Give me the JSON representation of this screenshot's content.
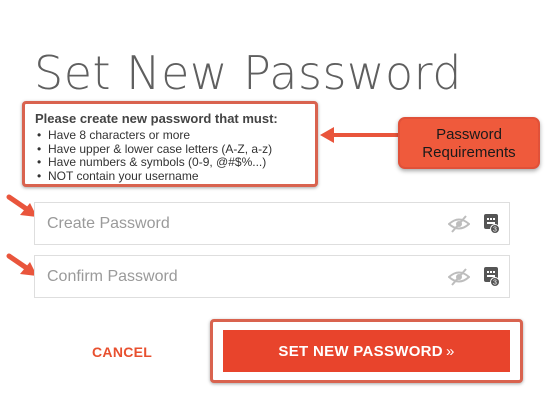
{
  "title": "Set New Password",
  "requirements": {
    "heading": "Please create new password that must:",
    "items": [
      "Have 8 characters or more",
      "Have upper & lower case letters (A-Z, a-z)",
      "Have numbers & symbols (0-9, @#$%...)",
      "NOT contain your username"
    ]
  },
  "callout": {
    "line1": "Password",
    "line2": "Requirements"
  },
  "fields": {
    "create_placeholder": "Create Password",
    "confirm_placeholder": "Confirm Password"
  },
  "keyboard_badge": "3",
  "actions": {
    "cancel_label": "CANCEL",
    "submit_label": "SET NEW PASSWORD",
    "submit_chevron": "»"
  },
  "colors": {
    "accent": "#e8442c",
    "callout": "#ef5a3c",
    "highlight_border": "#d9634f"
  },
  "icons": [
    "eye-slash-icon",
    "keyboard-icon",
    "arrow-pointer-icon"
  ]
}
